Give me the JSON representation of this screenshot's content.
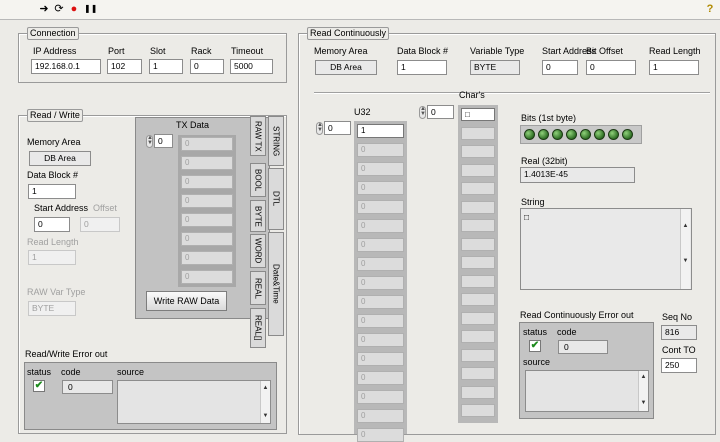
{
  "toolbar": {
    "run_icon": "➜",
    "cont_icon": "⟳",
    "stop_icon": "●",
    "pause_icon": "❚❚",
    "help_icon": "?"
  },
  "connection": {
    "title": "Connection",
    "ip_label": "IP Address",
    "ip_value": "192.168.0.1",
    "port_label": "Port",
    "port_value": "102",
    "slot_label": "Slot",
    "slot_value": "1",
    "rack_label": "Rack",
    "rack_value": "0",
    "timeout_label": "Timeout",
    "timeout_value": "5000"
  },
  "read_write": {
    "title": "Read / Write",
    "memory_area_label": "Memory Area",
    "memory_area_value": "DB Area",
    "data_block_label": "Data Block #",
    "data_block_value": "1",
    "start_address_label": "Start Address",
    "start_address_value": "0",
    "offset_label": "Offset",
    "offset_value": "0",
    "read_length_label": "Read Length",
    "read_length_value": "1",
    "raw_var_type_label": "RAW Var Type",
    "raw_var_type_value": "BYTE",
    "tx_data_label": "TX Data",
    "tx_index": "0",
    "tx_values": [
      "0",
      "0",
      "0",
      "0",
      "0",
      "0",
      "0",
      "0"
    ],
    "write_button": "Write RAW Data",
    "tabs": [
      "RAW TX",
      "BOOL",
      "BYTE",
      "WORD",
      "REAL",
      "REAL[]"
    ],
    "side_tabs": [
      "STRING",
      "DTL",
      "Date&Time"
    ],
    "error_title": "Read/Write Error out",
    "status_label": "status",
    "code_label": "code",
    "code_value": "0",
    "source_label": "source",
    "status_mark": "✔"
  },
  "read_cont": {
    "title": "Read Continuously",
    "memory_area_label": "Memory Area",
    "memory_area_value": "DB Area",
    "data_block_label": "Data Block #",
    "data_block_value": "1",
    "variable_type_label": "Variable Type",
    "variable_type_value": "BYTE",
    "start_address_label": "Start Address",
    "start_address_value": "0",
    "bit_offset_label": "Bit Offset",
    "bit_offset_value": "0",
    "read_length_label": "Read Length",
    "read_length_value": "1",
    "u32_label": "U32",
    "u32_index": "0",
    "u32_values": [
      "1",
      "0",
      "0",
      "0",
      "0",
      "0",
      "0",
      "0",
      "0",
      "0",
      "0",
      "0",
      "0",
      "0",
      "0",
      "0",
      "0"
    ],
    "chars_label": "Char's",
    "chars_index": "0",
    "chars_first": "□",
    "bits_label": "Bits (1st byte)",
    "real_label": "Real (32bit)",
    "real_value": "1.4013E-45",
    "string_label": "String",
    "string_value": "□",
    "error_title": "Read Continuously Error out",
    "status_label": "status",
    "code_label": "code",
    "code_value": "0",
    "source_label": "source",
    "status_mark": "✔",
    "seq_label": "Seq No",
    "seq_value": "816",
    "cont_to_label": "Cont TO",
    "cont_to_value": "250"
  }
}
